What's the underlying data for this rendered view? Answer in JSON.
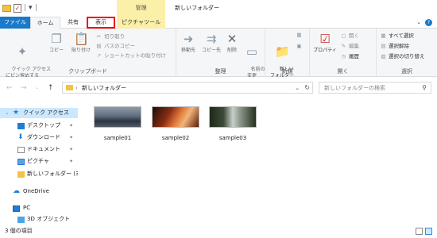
{
  "titlebar": {
    "context_label": "管理",
    "window_title": "新しいフォルダー"
  },
  "tabs": {
    "file": "ファイル",
    "home": "ホーム",
    "share": "共有",
    "view": "表示",
    "picture_tools": "ピクチャツール"
  },
  "ribbon": {
    "clipboard": {
      "pin_quick_access": "クイック アクセス\nにピン留めする",
      "copy": "コピー",
      "paste": "貼り付け",
      "cut": "切り取り",
      "copy_path": "パスのコピー",
      "paste_shortcut": "ショートカットの貼り付け",
      "label": "クリップボード"
    },
    "organize": {
      "move_to": "移動先",
      "copy_to": "コピー先",
      "delete": "削除",
      "rename": "名前の\n変更",
      "label": "整理"
    },
    "new": {
      "new_folder": "新しい\nフォルダー",
      "label": "新規"
    },
    "open": {
      "properties": "プロパティ",
      "open": "開く",
      "edit": "編集",
      "history": "履歴",
      "label": "開く"
    },
    "select": {
      "select_all": "すべて選択",
      "select_none": "選択解除",
      "invert": "選択の切り替え",
      "label": "選択"
    }
  },
  "address": {
    "path": "新しいフォルダー",
    "search_placeholder": "新しいフォルダーの検索"
  },
  "navpane": {
    "items": [
      {
        "label": "クイック アクセス",
        "icon": "star-icon"
      },
      {
        "label": "デスクトップ",
        "icon": "desktop-icon"
      },
      {
        "label": "ダウンロード",
        "icon": "download-icon"
      },
      {
        "label": "ドキュメント",
        "icon": "document-icon"
      },
      {
        "label": "ピクチャ",
        "icon": "picture-icon"
      },
      {
        "label": "新しいフォルダー (3",
        "icon": "folder-icon"
      },
      {
        "label": "OneDrive",
        "icon": "onedrive-icon"
      },
      {
        "label": "PC",
        "icon": "pc-icon"
      },
      {
        "label": "3D オブジェクト",
        "icon": "3d-objects-icon"
      }
    ]
  },
  "files": [
    {
      "name": "sample01"
    },
    {
      "name": "sample02"
    },
    {
      "name": "sample03"
    }
  ],
  "status": {
    "item_count": "3 個の項目"
  },
  "colors": {
    "file_tab": "#1979ca",
    "picture_tools_tab": "#fcf0a8",
    "highlight_border": "#e00000",
    "selection": "#cce8ff"
  }
}
